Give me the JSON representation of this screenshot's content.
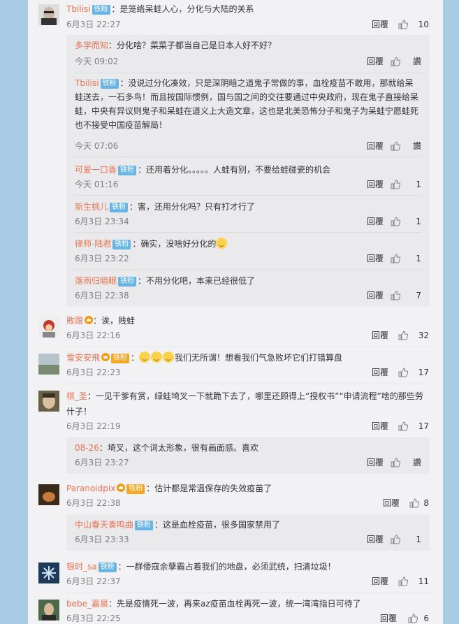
{
  "comments": [
    {
      "user": "Tbilisi",
      "badge": "铁粉",
      "text": "：是笼络呆蛙人心，分化与大陆的关系",
      "time": "6月3日 22:27",
      "reply_label": "回覆",
      "likes": "10",
      "replies": [
        {
          "user": "多学而知",
          "badge": "",
          "text": "：分化啥？菜菜子都当自己是日本人好不好？",
          "time": "今天 09:02",
          "reply_label": "回覆",
          "likes": "讚"
        },
        {
          "user": "Tbilisi",
          "badge": "铁粉",
          "text": "：没说过分化凑效，只是深阴暗之道鬼子常做的事，血栓疫苗不敢用，那就给呆蛙送去，一石多鸟！而且按国际惯例，国与国之间的交往要通过中央政府，现在鬼子直接给呆蛙，中央有异议则鬼子和呆蛙在道义上大造文章，这也是北美恐怖分子和鬼子为呆蛙宁愿蛙死也不接受中国疫苗解局！",
          "time": "今天 07:06",
          "reply_label": "回覆",
          "likes": "讚"
        },
        {
          "user": "可爱一口香",
          "badge": "铁粉",
          "text": "：还用着分化。。。。。人蛙有别，不要给蛙碰瓷的机会",
          "time": "今天 01:16",
          "reply_label": "回覆",
          "likes": "1"
        },
        {
          "user": "新生桃儿",
          "badge": "铁粉",
          "text": "：害，还用分化吗？只有打才行了",
          "time": "6月3日 23:34",
          "reply_label": "回覆",
          "likes": "1"
        },
        {
          "user": "律师-陆君",
          "badge": "铁粉",
          "text": "：确实，没啥好分化的",
          "time": "6月3日 23:22",
          "reply_label": "回覆",
          "likes": "1"
        },
        {
          "user": "落雨归暗眠",
          "badge": "铁粉",
          "text": "：不用分化吧，本来已经很低了",
          "time": "6月3日 22:38",
          "reply_label": "回覆",
          "likes": "7"
        }
      ]
    },
    {
      "user": "敗蹬",
      "badge": "",
      "text": "：诶，贱蛙",
      "time": "6月3日 22:16",
      "reply_label": "回覆",
      "likes": "32",
      "replies": []
    },
    {
      "user": "雪安安飛",
      "badge": "铁粉",
      "text": "我们无所谓！想看我们气急败坏它们打错算盘",
      "time": "6月3日 22:23",
      "reply_label": "回覆",
      "likes": "17",
      "replies": []
    },
    {
      "user": "棋_圣",
      "badge": "",
      "text": "：一见干爹有赏，绿蛙埼叉一下就跪下去了，哪里还顾得上“授权书”“申请流程”啥的那些劳什子！",
      "time": "6月3日 22:19",
      "reply_label": "回覆",
      "likes": "17",
      "replies": [
        {
          "user": "08-26",
          "badge": "",
          "text": "：埼叉，这个词太形象，很有画面感。喜欢",
          "time": "6月3日 23:27",
          "reply_label": "回覆",
          "likes": "讚"
        }
      ]
    },
    {
      "user": "Paranoidpix",
      "badge": "铁粉",
      "text": "：估计都是常温保存的失效疫苗了",
      "time": "6月3日 22:38",
      "reply_label": "回覆",
      "likes": "8",
      "replies": [
        {
          "user": "中山春天奏鸣曲",
          "badge": "铁粉",
          "text": "：这是血栓疫苗，很多国家禁用了",
          "time": "6月3日 23:33",
          "reply_label": "回覆",
          "likes": "1"
        }
      ]
    },
    {
      "user": "银时_sa",
      "badge": "铁粉",
      "text": "：一群倭寇余孽霸占着我们的地盘，必须武统，扫清垃圾！",
      "time": "6月3日 22:37",
      "reply_label": "回覆",
      "likes": "11",
      "replies": []
    },
    {
      "user": "bebe_嘉晨",
      "badge": "",
      "text": "：先是疫情死一波，再来az疫苗血栓再死一波，统一湾湾指日可待了",
      "time": "6月3日 22:25",
      "reply_label": "回覆",
      "likes": "6",
      "replies": []
    }
  ],
  "colors": {
    "username": "#eb7350",
    "badge": "#69b4e6",
    "page_bg": "#a9cbe3",
    "panel_bg": "#f2f2f5"
  },
  "icons": {
    "like": "thumbs-up-icon",
    "crown": "crown-icon",
    "emoji": "smile-emoji-icon"
  }
}
